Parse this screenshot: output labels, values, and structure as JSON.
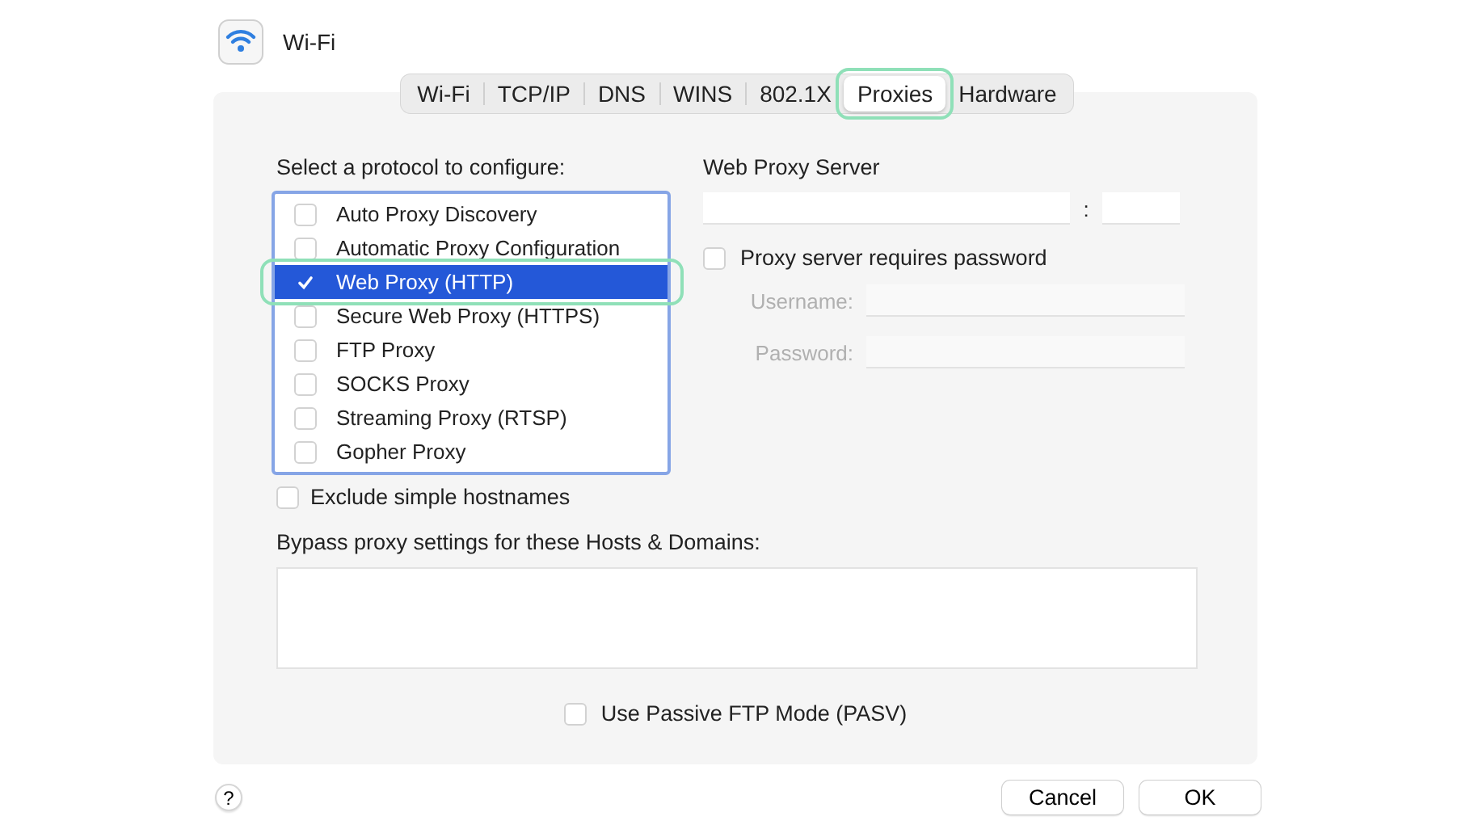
{
  "window": {
    "title": "Wi-Fi"
  },
  "tabs": [
    {
      "label": "Wi-Fi",
      "selected": false,
      "highlighted": false
    },
    {
      "label": "TCP/IP",
      "selected": false,
      "highlighted": false
    },
    {
      "label": "DNS",
      "selected": false,
      "highlighted": false
    },
    {
      "label": "WINS",
      "selected": false,
      "highlighted": false
    },
    {
      "label": "802.1X",
      "selected": false,
      "highlighted": false
    },
    {
      "label": "Proxies",
      "selected": true,
      "highlighted": true
    },
    {
      "label": "Hardware",
      "selected": false,
      "highlighted": false
    }
  ],
  "protocols": {
    "label": "Select a protocol to configure:",
    "items": [
      {
        "label": "Auto Proxy Discovery",
        "checked": false,
        "selected": false,
        "highlighted": false
      },
      {
        "label": "Automatic Proxy Configuration",
        "checked": false,
        "selected": false,
        "highlighted": false
      },
      {
        "label": "Web Proxy (HTTP)",
        "checked": true,
        "selected": true,
        "highlighted": true
      },
      {
        "label": "Secure Web Proxy (HTTPS)",
        "checked": false,
        "selected": false,
        "highlighted": false
      },
      {
        "label": "FTP Proxy",
        "checked": false,
        "selected": false,
        "highlighted": false
      },
      {
        "label": "SOCKS Proxy",
        "checked": false,
        "selected": false,
        "highlighted": false
      },
      {
        "label": "Streaming Proxy (RTSP)",
        "checked": false,
        "selected": false,
        "highlighted": false
      },
      {
        "label": "Gopher Proxy",
        "checked": false,
        "selected": false,
        "highlighted": false
      }
    ]
  },
  "server": {
    "label": "Web Proxy Server",
    "separator": ":",
    "requires_password": {
      "label": "Proxy server requires password",
      "checked": false
    },
    "username": {
      "label": "Username:",
      "disabled": true
    },
    "password": {
      "label": "Password:",
      "disabled": true
    }
  },
  "exclude_simple": {
    "label": "Exclude simple hostnames",
    "checked": false
  },
  "bypass": {
    "label": "Bypass proxy settings for these Hosts & Domains:"
  },
  "passive_ftp": {
    "label": "Use Passive FTP Mode (PASV)",
    "checked": false
  },
  "help": "?",
  "buttons": [
    "Cancel",
    "OK"
  ]
}
